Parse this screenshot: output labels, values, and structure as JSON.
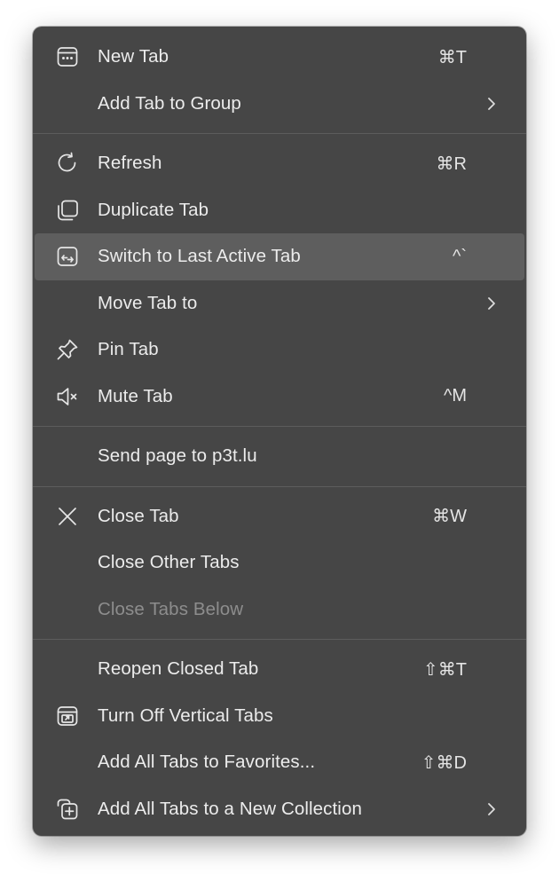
{
  "menu": {
    "new_tab": {
      "label": "New Tab",
      "shortcut": "⌘T",
      "icon": "new-tab-icon"
    },
    "add_tab_to_group": {
      "label": "Add Tab to Group"
    },
    "refresh": {
      "label": "Refresh",
      "shortcut": "⌘R",
      "icon": "refresh-icon"
    },
    "duplicate_tab": {
      "label": "Duplicate Tab",
      "icon": "duplicate-icon"
    },
    "switch_last_tab": {
      "label": "Switch to Last Active Tab",
      "shortcut": "^`",
      "icon": "switch-tab-icon"
    },
    "move_tab_to": {
      "label": "Move Tab to"
    },
    "pin_tab": {
      "label": "Pin Tab",
      "icon": "pin-icon"
    },
    "mute_tab": {
      "label": "Mute Tab",
      "shortcut": "^M",
      "icon": "mute-icon"
    },
    "send_page": {
      "label": "Send page to p3t.lu"
    },
    "close_tab": {
      "label": "Close Tab",
      "shortcut": "⌘W",
      "icon": "close-icon"
    },
    "close_other_tabs": {
      "label": "Close Other Tabs"
    },
    "close_tabs_below": {
      "label": "Close Tabs Below",
      "disabled": true
    },
    "reopen_closed_tab": {
      "label": "Reopen Closed Tab",
      "shortcut": "⇧⌘T"
    },
    "turn_off_vertical_tabs": {
      "label": "Turn Off Vertical Tabs",
      "icon": "vertical-tabs-icon"
    },
    "add_all_to_favorites": {
      "label": "Add All Tabs to Favorites...",
      "shortcut": "⇧⌘D"
    },
    "add_all_to_collection": {
      "label": "Add All Tabs to a New Collection",
      "icon": "collection-add-icon"
    }
  },
  "colors": {
    "menu_bg": "#464646",
    "highlight_bg": "#5e5e5e",
    "text": "#ececec",
    "disabled_text": "#8d8d8d",
    "separator": "#5d5d5d"
  }
}
